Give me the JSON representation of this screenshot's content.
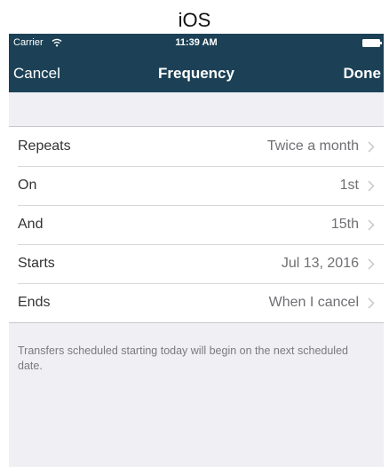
{
  "caption": "iOS",
  "status_bar": {
    "carrier": "Carrier",
    "wifi_icon": "wifi-icon",
    "time": "11:39 AM",
    "battery_icon": "battery-icon"
  },
  "nav_bar": {
    "cancel_label": "Cancel",
    "title": "Frequency",
    "done_label": "Done",
    "background_color": "#1c4156"
  },
  "rows": [
    {
      "label": "Repeats",
      "value": "Twice a month"
    },
    {
      "label": "On",
      "value": "1st"
    },
    {
      "label": "And",
      "value": "15th"
    },
    {
      "label": "Starts",
      "value": "Jul 13, 2016"
    },
    {
      "label": "Ends",
      "value": "When I cancel"
    }
  ],
  "row_chevron_icon": "chevron-right-icon",
  "footer_note": "Transfers scheduled starting today will begin on the next scheduled date."
}
